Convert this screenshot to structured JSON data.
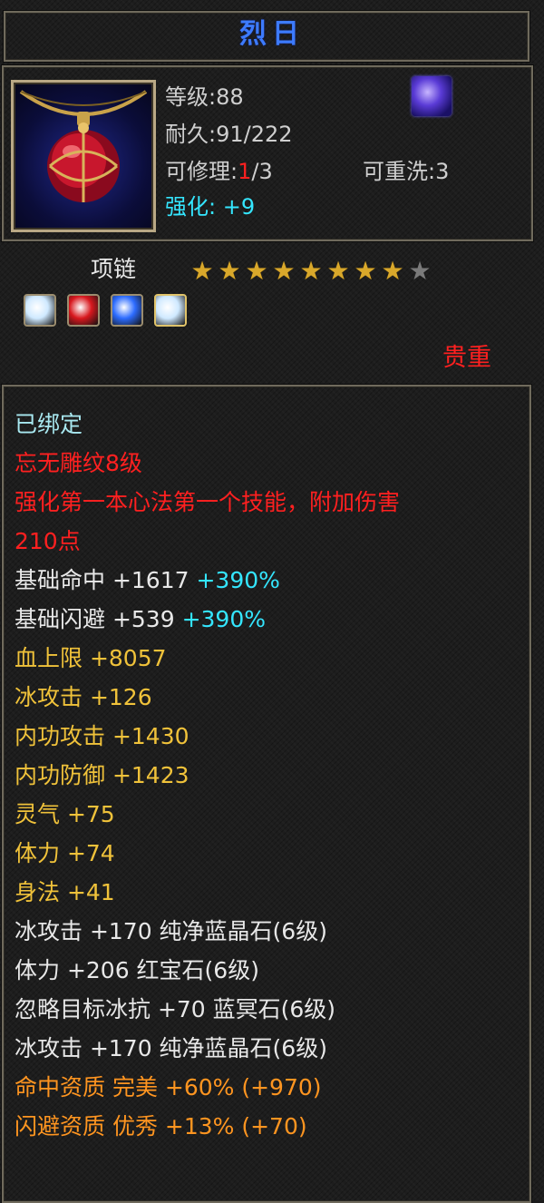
{
  "item": {
    "name": "烈日",
    "level_label": "等级:88",
    "durability_label": "耐久:91/222",
    "repair_prefix": "可修理:",
    "repair_current": "1",
    "repair_suffix": "/3",
    "rewash_label": "可重洗:3",
    "enhance_label": "强化: +9",
    "type_label": "项链",
    "rarity": "贵重",
    "stars_total": 9,
    "stars_filled": 8
  },
  "gems": [
    {
      "name": "diamond-gem-icon",
      "color": "#cfe9ff"
    },
    {
      "name": "ruby-gem-icon",
      "color": "#d8181e"
    },
    {
      "name": "sapphire-gem-icon",
      "color": "#2d6cff"
    },
    {
      "name": "diamond-gem-icon",
      "color": "#cfe9ff"
    }
  ],
  "stats": {
    "bound": "已绑定",
    "engrave": "忘无雕纹8级",
    "engrave_desc_1": "强化第一本心法第一个技能，附加伤害",
    "engrave_desc_2": "210点",
    "base_hit": "基础命中 +1617",
    "base_hit_pct": "+390%",
    "base_dodge": "基础闪避 +539",
    "base_dodge_pct": "+390%",
    "hp": "血上限 +8057",
    "ice_attack": "冰攻击 +126",
    "inner_attack": "内功攻击 +1430",
    "inner_defense": "内功防御 +1423",
    "spirit": "灵气 +75",
    "stamina": "体力 +74",
    "agility": "身法 +41",
    "gem_line_1": "冰攻击 +170 纯净蓝晶石(6级)",
    "gem_line_2": "体力 +206 红宝石(6级)",
    "gem_line_3": "忽略目标冰抗 +70 蓝冥石(6级)",
    "gem_line_4": "冰攻击 +170 纯净蓝晶石(6级)",
    "apt_hit": "命中资质  完美 +60% (+970)",
    "apt_dodge": "闪避资质  优秀 +13% (+70)"
  }
}
